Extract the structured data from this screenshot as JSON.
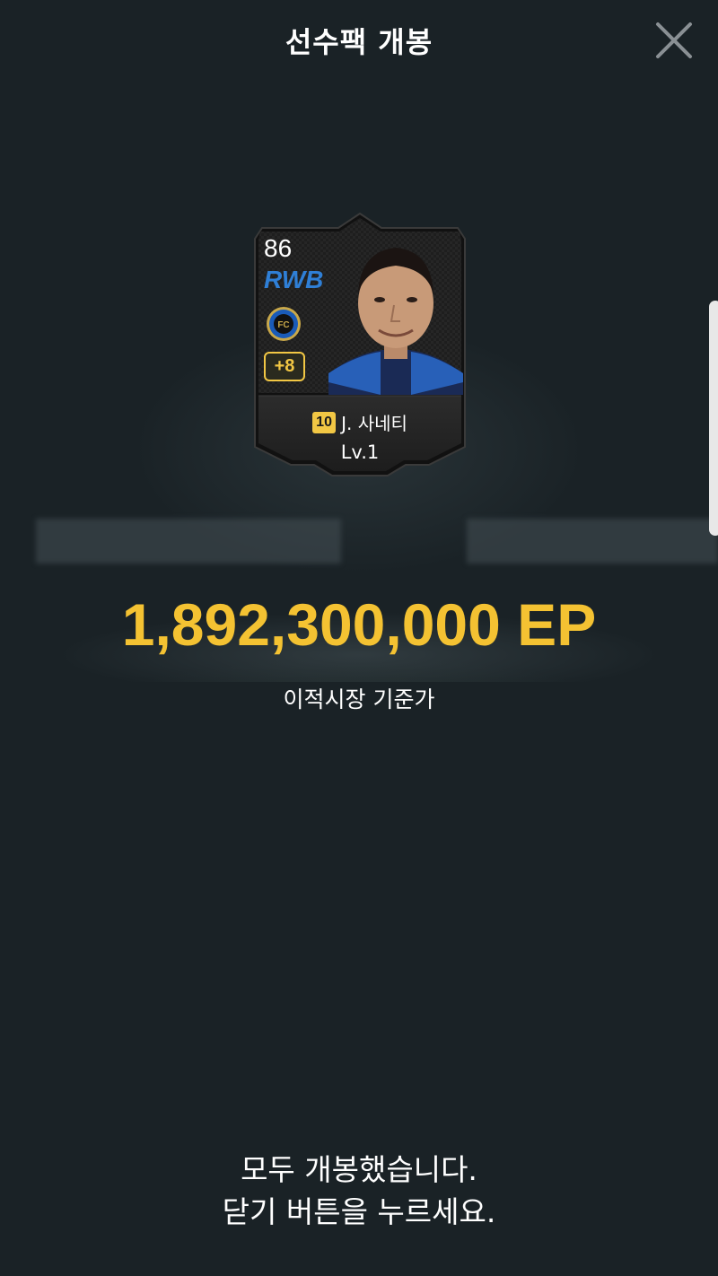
{
  "header": {
    "title": "선수팩 개봉",
    "close_icon": "close-icon"
  },
  "card": {
    "overall": "86",
    "position": "RWB",
    "position_color": "#2f7fd6",
    "club_crest_icon": "inter-crest-icon",
    "enhance": "+8",
    "season_badge": "10",
    "player_name": "J. 사네티",
    "level": "Lv.1"
  },
  "price": {
    "value": "1,892,300,000 EP",
    "caption": "이적시장 기준가",
    "color": "#f4c232"
  },
  "footer": {
    "line1": "모두 개봉했습니다.",
    "line2": "닫기 버튼을 누르세요."
  },
  "colors": {
    "background": "#1a2226",
    "accent_gold": "#f2c744"
  }
}
